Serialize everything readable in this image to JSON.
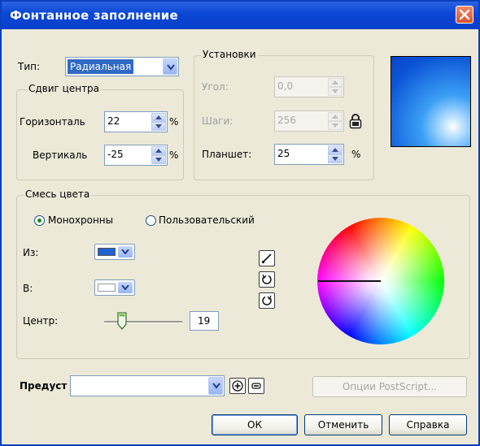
{
  "window": {
    "title": "Фонтанное заполнение"
  },
  "type_row": {
    "label": "Тип:",
    "value": "Радиальная"
  },
  "center_offset": {
    "legend": "Сдвиг центра",
    "horizontal_label": "Горизонталь",
    "horizontal_value": "22",
    "vertical_label": "Вертикаль",
    "vertical_value": "-25",
    "unit": "%"
  },
  "settings": {
    "legend": "Установки",
    "angle_label": "Угол:",
    "angle_value": "0,0",
    "steps_label": "Шаги:",
    "steps_value": "256",
    "pad_label": "Планшет:",
    "pad_value": "25",
    "unit": "%"
  },
  "color_blend": {
    "legend": "Смесь цвета",
    "mono_label": "Монохронны",
    "custom_label": "Пользовательский",
    "selected_mode": "mono",
    "from_label": "Из:",
    "from_color": "#1f62d0",
    "to_label": "В:",
    "to_color": "#ffffff",
    "center_label": "Центр:",
    "center_value": "19",
    "center_fraction": 0.19
  },
  "presets": {
    "label": "Предуст",
    "value": ""
  },
  "buttons": {
    "postscript": "Опции PostScript...",
    "ok": "ОК",
    "cancel": "Отменить",
    "help": "Справка"
  },
  "icons": {
    "close": "close-icon",
    "lock": "lock-icon",
    "linear_path": "direct-path-icon",
    "ccw_path": "counterclockwise-path-icon",
    "cw_path": "clockwise-path-icon",
    "add": "plus-icon",
    "remove": "minus-icon"
  }
}
